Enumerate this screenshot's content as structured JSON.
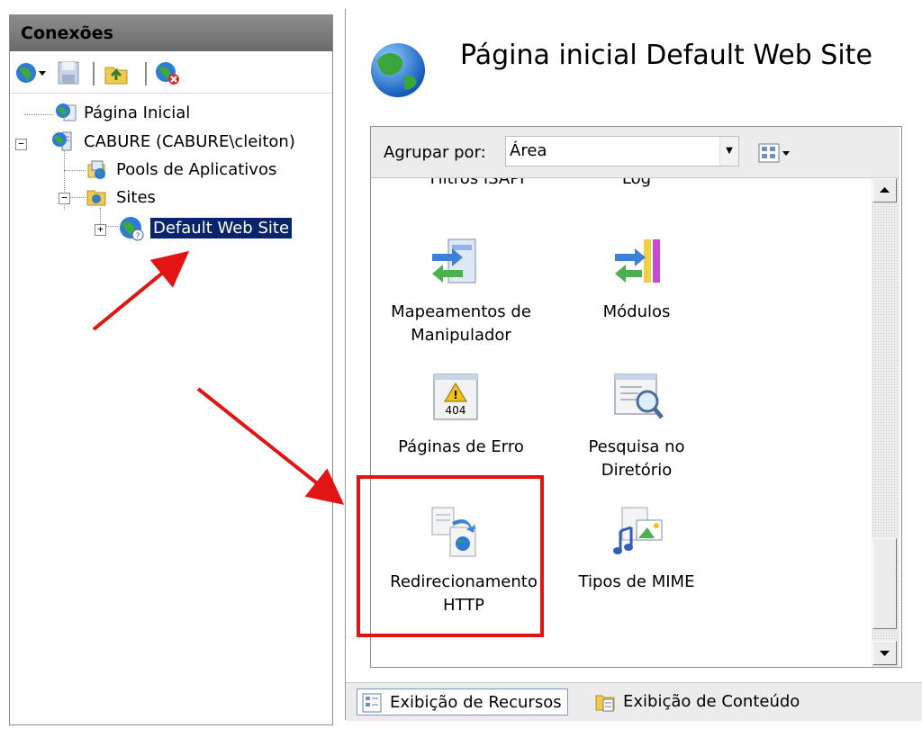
{
  "connections": {
    "header": "Conexões",
    "tree": {
      "start_page": "Página Inicial",
      "server": "CABURE (CABURE\\cleiton)",
      "app_pools": "Pools de Aplicativos",
      "sites": "Sites",
      "default_site": "Default Web Site"
    }
  },
  "main": {
    "title": "Página inicial Default Web Site",
    "group_by_label": "Agrupar por:",
    "group_by_value": "Área",
    "features": [
      {
        "label": "Filtros ISAPI",
        "icon": "isapi-filters-icon"
      },
      {
        "label": "Log",
        "icon": "log-icon"
      },
      {
        "label": "Mapeamentos de\nManipulador",
        "icon": "handler-mappings-icon"
      },
      {
        "label": "Módulos",
        "icon": "modules-icon"
      },
      {
        "label": "Páginas de Erro",
        "icon": "error-pages-icon"
      },
      {
        "label": "Pesquisa no\nDiretório",
        "icon": "directory-browsing-icon"
      },
      {
        "label": "Redirecionamento\nHTTP",
        "icon": "http-redirect-icon"
      },
      {
        "label": "Tipos de MIME",
        "icon": "mime-types-icon"
      }
    ],
    "error_badge": "404"
  },
  "tabs": {
    "features_view": "Exibição de Recursos",
    "content_view": "Exibição de Conteúdo"
  },
  "colors": {
    "highlight": "#e21414",
    "selection": "#0a246a",
    "header_bg": "#7c7c7c"
  }
}
